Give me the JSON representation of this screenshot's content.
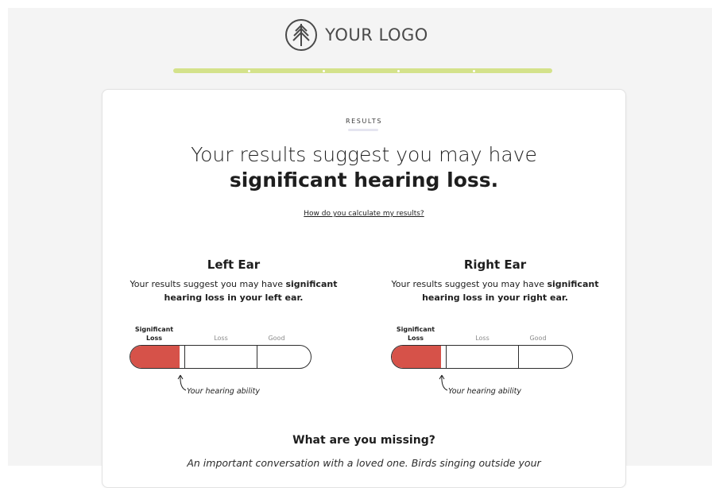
{
  "brand": {
    "logo_text": "YOUR LOGO",
    "accent": "#d4e28b",
    "danger": "#d65249"
  },
  "progress": {
    "steps": 5,
    "value": 1.0
  },
  "card": {
    "eyebrow": "RESULTS",
    "headline_pre": "Your results suggest you may have ",
    "headline_bold": "significant hearing loss.",
    "link_label": "How do you calculate my results?"
  },
  "left_ear": {
    "title": "Left Ear",
    "text_pre": "Your results suggest you may have ",
    "text_bold": "significant hearing loss in your left ear.",
    "scale": [
      "Significant Loss",
      "Loss",
      "Good"
    ],
    "level": "Significant Loss",
    "marker_label": "Your hearing ability"
  },
  "right_ear": {
    "title": "Right Ear",
    "text_pre": "Your results suggest you may have ",
    "text_bold": "significant hearing loss in your right ear.",
    "scale": [
      "Significant Loss",
      "Loss",
      "Good"
    ],
    "level": "Significant Loss",
    "marker_label": "Your hearing ability"
  },
  "missing": {
    "title": "What are you missing?",
    "body": "An important conversation with a loved one. Birds singing outside your"
  }
}
